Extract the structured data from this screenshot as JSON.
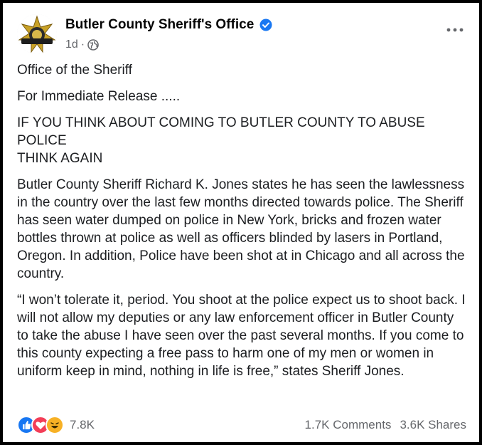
{
  "post": {
    "page_name": "Butler County Sheriff's Office",
    "time": "1d",
    "separator": "·",
    "paragraphs": [
      "Office of the Sheriff",
      "For Immediate Release .....",
      "IF YOU THINK ABOUT COMING TO BUTLER COUNTY TO ABUSE POLICE\nTHINK AGAIN",
      "Butler County Sheriff Richard K. Jones states he has seen the lawlessness in the country over the last few months directed towards police.  The Sheriff has seen water dumped on police in New York, bricks and frozen water bottles thrown at police as well as officers blinded by lasers in Portland, Oregon. In addition, Police have been shot at in Chicago and all across the country.",
      "“I won’t tolerate it, period.  You shoot at the police expect us to shoot back.  I will not allow my deputies or any law enforcement officer in Butler County to take the abuse I have seen over the past several months. If you come to this county expecting a free pass to harm one of my men or women in uniform keep in mind, nothing in life is free,” states Sheriff Jones."
    ],
    "reaction_count": "7.8K",
    "comments": "1.7K Comments",
    "shares": "3.6K Shares"
  },
  "colors": {
    "verified": "#1877f2",
    "like": "#1877f2",
    "love": "#f33e58",
    "haha": "#f7b125"
  },
  "icons": [
    "sheriff-badge-logo",
    "verified-icon",
    "globe-icon",
    "more-options-icon",
    "like-reaction-icon",
    "love-reaction-icon",
    "haha-reaction-icon"
  ]
}
